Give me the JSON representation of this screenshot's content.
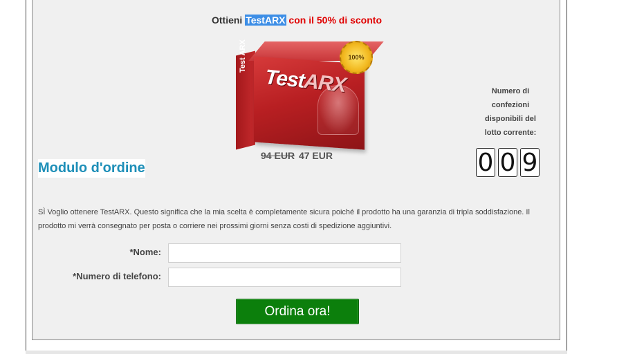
{
  "offer": {
    "prefix": "Ottieni",
    "brand": "TestARX",
    "suffix": "con il 50% di sconto"
  },
  "product": {
    "image_alt": "TestARX box",
    "box_logo_test": "Test",
    "box_logo_arx": "ARX",
    "side_text": "Test ARX",
    "seal_text": "100%"
  },
  "price": {
    "old": "94 EUR",
    "new": "47 EUR"
  },
  "stock": {
    "label": "Numero di confezioni disponibili del lotto corrente:",
    "digits": [
      "0",
      "0",
      "9"
    ]
  },
  "form": {
    "title": "Modulo d'ordine",
    "description": "SÌ Voglio ottenere TestARX. Questo significa che la mia scelta è completamente sicura poiché il prodotto ha una garanzia di tripla soddisfazione. Il prodotto mi verrà consegnato per posta o corriere nei prossimi giorni senza costi di spedizione aggiuntivi.",
    "name_label": "*Nome:",
    "name_value": "",
    "phone_label": "*Numero di telefono:",
    "phone_value": "",
    "submit_label": "Ordina ora!"
  },
  "colors": {
    "accent_title": "#1e8fb8",
    "offer_red": "#e00000",
    "submit_green": "#0c7f0c",
    "brand_highlight": "#3d8ee6"
  }
}
